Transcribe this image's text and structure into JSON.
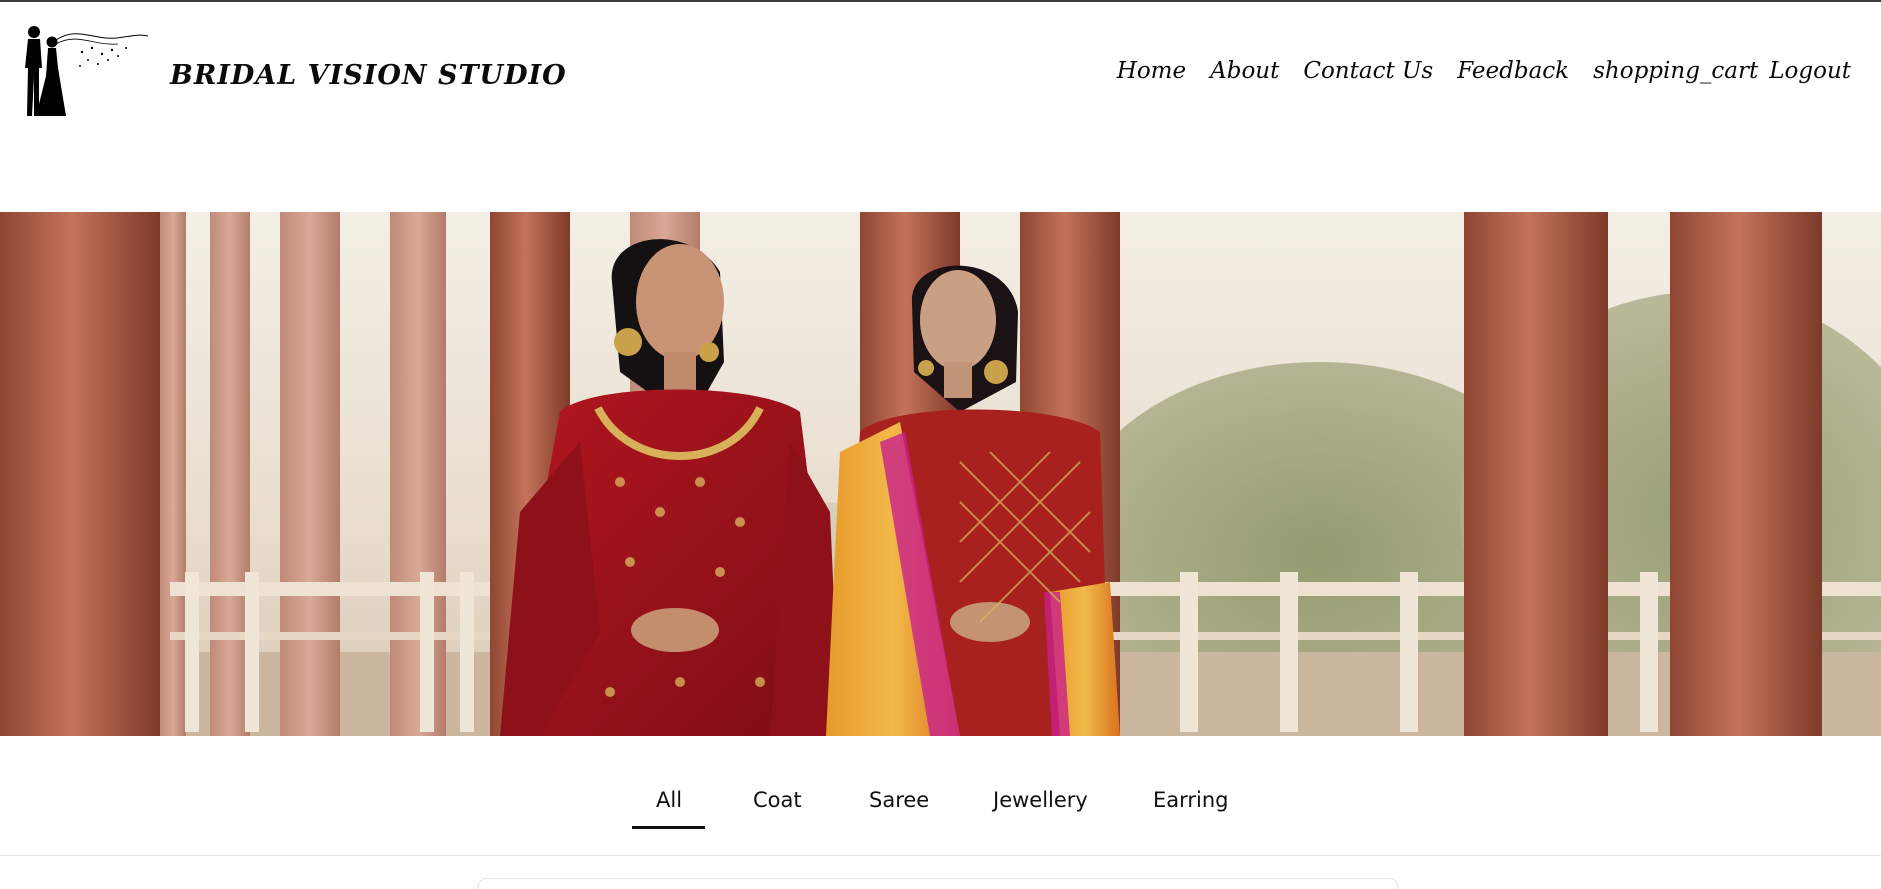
{
  "brand": {
    "name": "BRIDAL VISION STUDIO",
    "logo_icon": "bride-groom-silhouette-icon"
  },
  "nav": {
    "items": [
      "Home",
      "About",
      "Contact Us",
      "Feedback",
      "shopping_cart",
      "Logout"
    ]
  },
  "hero": {
    "image": "two models in bridal wear between red sandstone columns"
  },
  "tabs": {
    "items": [
      "All",
      "Coat",
      "Saree",
      "Jewellery",
      "Earring"
    ],
    "active": "All"
  },
  "colors": {
    "text": "#111111",
    "active_underline": "#111111",
    "column": "#b2614a",
    "dress_red": "#a3141f",
    "dupatta_orange": "#e79a2a"
  }
}
